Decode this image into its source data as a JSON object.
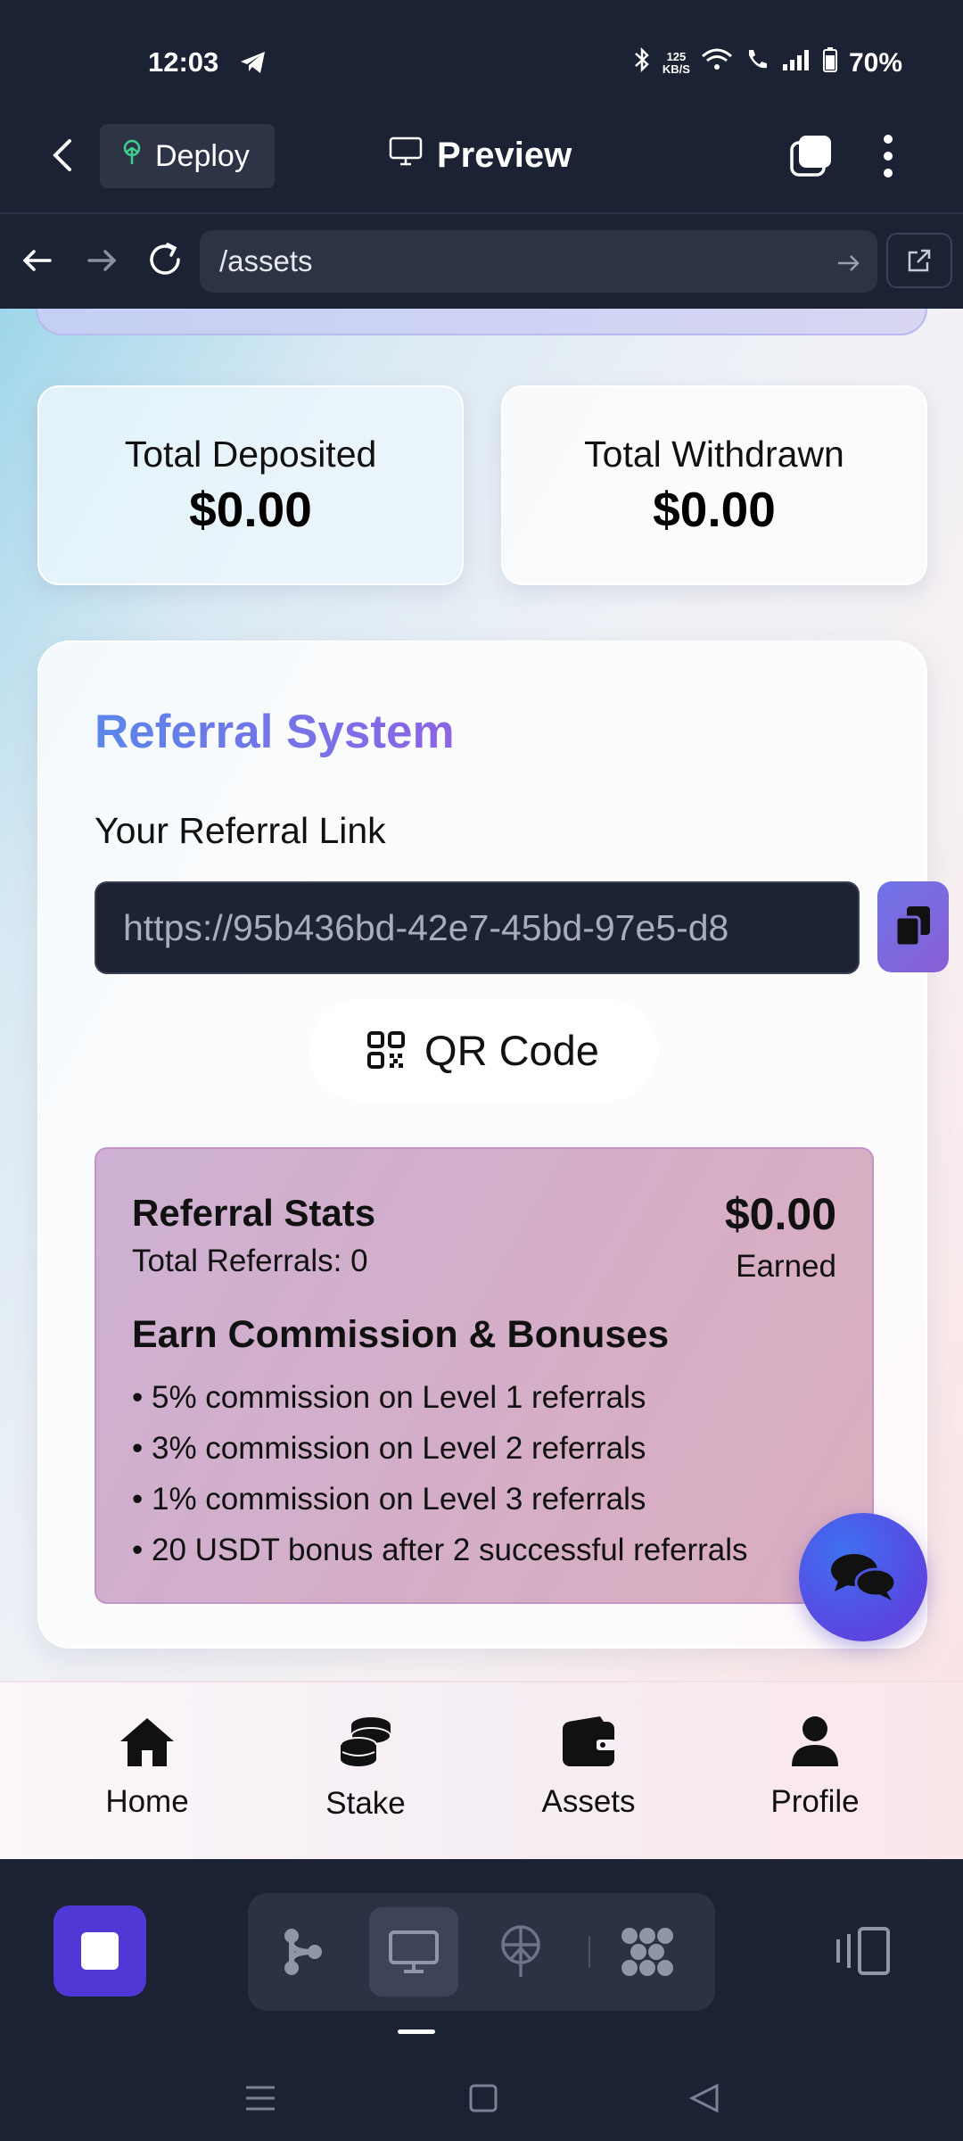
{
  "status_bar": {
    "time": "12:03",
    "net_speed_value": "125",
    "net_speed_unit": "KB/S",
    "battery": "70%"
  },
  "app_bar": {
    "deploy_label": "Deploy",
    "preview_label": "Preview"
  },
  "url_bar": {
    "url": "/assets"
  },
  "stats": {
    "deposited_label": "Total Deposited",
    "deposited_value": "$0.00",
    "withdrawn_label": "Total Withdrawn",
    "withdrawn_value": "$0.00"
  },
  "referral": {
    "title": "Referral System",
    "link_label": "Your Referral Link",
    "link_value": "https://95b436bd-42e7-45bd-97e5-d8",
    "qr_label": "QR Code",
    "stats_title": "Referral Stats",
    "total_referrals": "Total Referrals: 0",
    "earned_amount": "$0.00",
    "earned_label": "Earned",
    "commission_title": "Earn Commission & Bonuses",
    "bullets": [
      "• 5% commission on Level 1 referrals",
      "• 3% commission on Level 2 referrals",
      "• 1% commission on Level 3 referrals",
      "• 20 USDT bonus after 2 successful referrals"
    ]
  },
  "bottom_nav": {
    "items": [
      {
        "label": "Home",
        "icon": "home-icon"
      },
      {
        "label": "Stake",
        "icon": "coins-icon"
      },
      {
        "label": "Assets",
        "icon": "wallet-icon"
      },
      {
        "label": "Profile",
        "icon": "user-icon"
      }
    ]
  },
  "colors": {
    "accent": "#5038d6",
    "dark_bg": "#1b2233",
    "title_gradient_start": "#5a86ea",
    "title_gradient_end": "#8d63e4"
  }
}
